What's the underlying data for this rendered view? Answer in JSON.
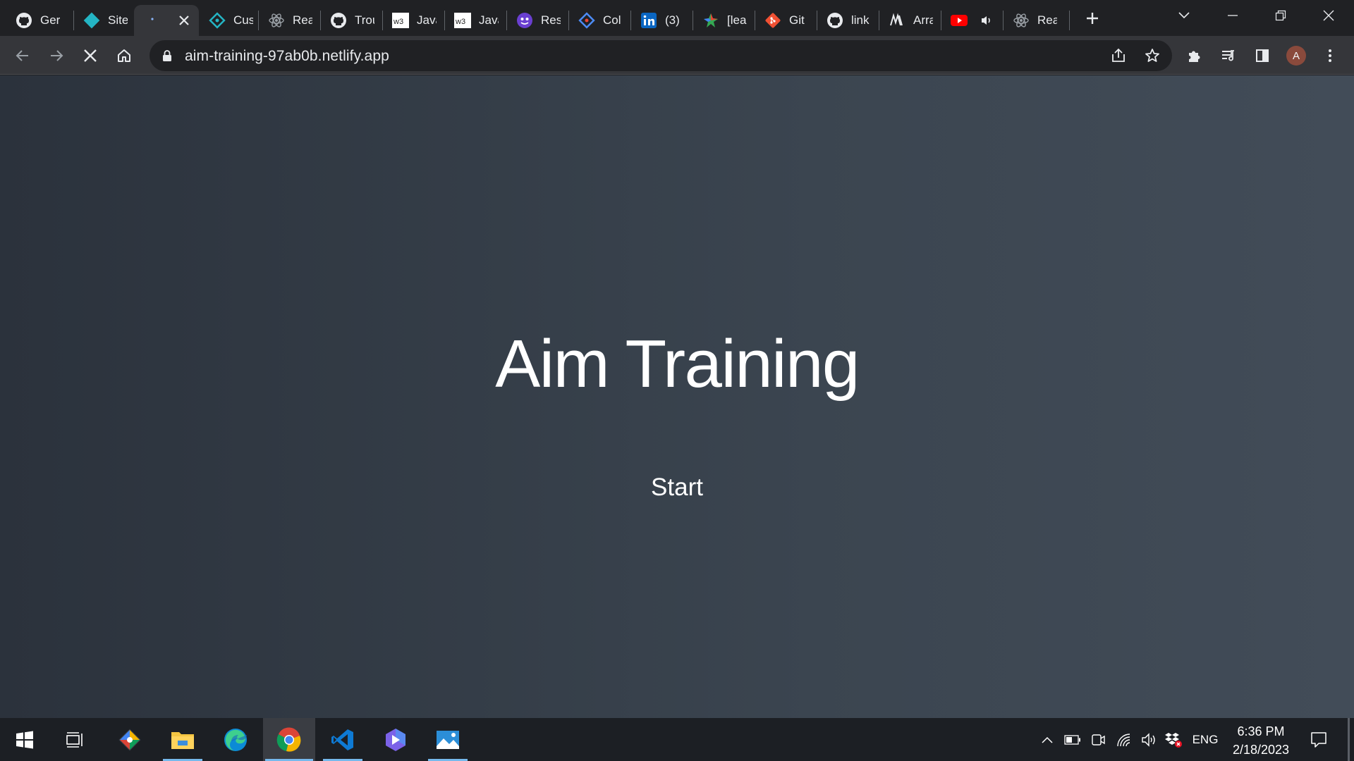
{
  "browser": {
    "tabs": [
      {
        "label": "Ger",
        "icon": "github-icon"
      },
      {
        "label": "Site",
        "icon": "netlify-icon"
      },
      {
        "label": "",
        "icon": "loading-icon",
        "active": true
      },
      {
        "label": "Cus",
        "icon": "netlify-icon"
      },
      {
        "label": "Rea",
        "icon": "react-icon"
      },
      {
        "label": "Trou",
        "icon": "github-icon"
      },
      {
        "label": "Java",
        "icon": "w3schools-icon"
      },
      {
        "label": "Java",
        "icon": "w3schools-icon"
      },
      {
        "label": "Res",
        "icon": "mascot-icon"
      },
      {
        "label": "Col",
        "icon": "diamond-icon"
      },
      {
        "label": "(3)",
        "icon": "linkedin-icon"
      },
      {
        "label": "[lea",
        "icon": "leaf-icon"
      },
      {
        "label": "Git",
        "icon": "git-icon"
      },
      {
        "label": "link",
        "icon": "github-icon"
      },
      {
        "label": "Arra",
        "icon": "medium-icon"
      },
      {
        "label": "",
        "icon": "youtube-icon",
        "muted": true
      },
      {
        "label": "Rea",
        "icon": "react-icon"
      }
    ],
    "w3_text": "w3",
    "url": "aim-training-97ab0b.netlify.app",
    "profile_initial": "A"
  },
  "page": {
    "title": "Aim Training",
    "start_label": "Start"
  },
  "taskbar": {
    "language": "ENG",
    "time": "6:36 PM",
    "date": "2/18/2023"
  },
  "colors": {
    "page_gradient_start": "#2b323c",
    "page_gradient_end": "#424c58",
    "chrome_dark": "#202124",
    "chrome_toolbar": "#35363a"
  }
}
